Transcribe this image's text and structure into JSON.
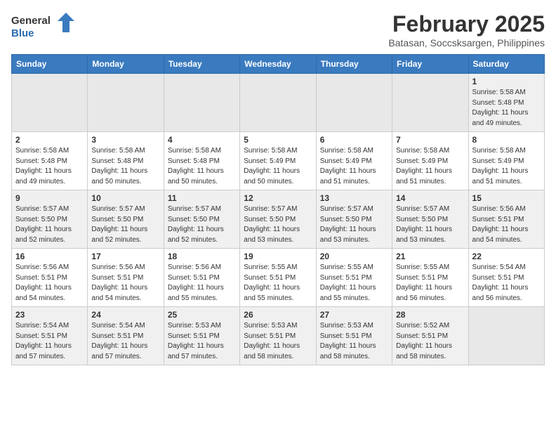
{
  "header": {
    "logo_general": "General",
    "logo_blue": "Blue",
    "month_year": "February 2025",
    "location": "Batasan, Soccsksargen, Philippines"
  },
  "days_of_week": [
    "Sunday",
    "Monday",
    "Tuesday",
    "Wednesday",
    "Thursday",
    "Friday",
    "Saturday"
  ],
  "weeks": [
    [
      {
        "day": "",
        "info": ""
      },
      {
        "day": "",
        "info": ""
      },
      {
        "day": "",
        "info": ""
      },
      {
        "day": "",
        "info": ""
      },
      {
        "day": "",
        "info": ""
      },
      {
        "day": "",
        "info": ""
      },
      {
        "day": "1",
        "info": "Sunrise: 5:58 AM\nSunset: 5:48 PM\nDaylight: 11 hours\nand 49 minutes."
      }
    ],
    [
      {
        "day": "2",
        "info": "Sunrise: 5:58 AM\nSunset: 5:48 PM\nDaylight: 11 hours\nand 49 minutes."
      },
      {
        "day": "3",
        "info": "Sunrise: 5:58 AM\nSunset: 5:48 PM\nDaylight: 11 hours\nand 50 minutes."
      },
      {
        "day": "4",
        "info": "Sunrise: 5:58 AM\nSunset: 5:48 PM\nDaylight: 11 hours\nand 50 minutes."
      },
      {
        "day": "5",
        "info": "Sunrise: 5:58 AM\nSunset: 5:49 PM\nDaylight: 11 hours\nand 50 minutes."
      },
      {
        "day": "6",
        "info": "Sunrise: 5:58 AM\nSunset: 5:49 PM\nDaylight: 11 hours\nand 51 minutes."
      },
      {
        "day": "7",
        "info": "Sunrise: 5:58 AM\nSunset: 5:49 PM\nDaylight: 11 hours\nand 51 minutes."
      },
      {
        "day": "8",
        "info": "Sunrise: 5:58 AM\nSunset: 5:49 PM\nDaylight: 11 hours\nand 51 minutes."
      }
    ],
    [
      {
        "day": "9",
        "info": "Sunrise: 5:57 AM\nSunset: 5:50 PM\nDaylight: 11 hours\nand 52 minutes."
      },
      {
        "day": "10",
        "info": "Sunrise: 5:57 AM\nSunset: 5:50 PM\nDaylight: 11 hours\nand 52 minutes."
      },
      {
        "day": "11",
        "info": "Sunrise: 5:57 AM\nSunset: 5:50 PM\nDaylight: 11 hours\nand 52 minutes."
      },
      {
        "day": "12",
        "info": "Sunrise: 5:57 AM\nSunset: 5:50 PM\nDaylight: 11 hours\nand 53 minutes."
      },
      {
        "day": "13",
        "info": "Sunrise: 5:57 AM\nSunset: 5:50 PM\nDaylight: 11 hours\nand 53 minutes."
      },
      {
        "day": "14",
        "info": "Sunrise: 5:57 AM\nSunset: 5:50 PM\nDaylight: 11 hours\nand 53 minutes."
      },
      {
        "day": "15",
        "info": "Sunrise: 5:56 AM\nSunset: 5:51 PM\nDaylight: 11 hours\nand 54 minutes."
      }
    ],
    [
      {
        "day": "16",
        "info": "Sunrise: 5:56 AM\nSunset: 5:51 PM\nDaylight: 11 hours\nand 54 minutes."
      },
      {
        "day": "17",
        "info": "Sunrise: 5:56 AM\nSunset: 5:51 PM\nDaylight: 11 hours\nand 54 minutes."
      },
      {
        "day": "18",
        "info": "Sunrise: 5:56 AM\nSunset: 5:51 PM\nDaylight: 11 hours\nand 55 minutes."
      },
      {
        "day": "19",
        "info": "Sunrise: 5:55 AM\nSunset: 5:51 PM\nDaylight: 11 hours\nand 55 minutes."
      },
      {
        "day": "20",
        "info": "Sunrise: 5:55 AM\nSunset: 5:51 PM\nDaylight: 11 hours\nand 55 minutes."
      },
      {
        "day": "21",
        "info": "Sunrise: 5:55 AM\nSunset: 5:51 PM\nDaylight: 11 hours\nand 56 minutes."
      },
      {
        "day": "22",
        "info": "Sunrise: 5:54 AM\nSunset: 5:51 PM\nDaylight: 11 hours\nand 56 minutes."
      }
    ],
    [
      {
        "day": "23",
        "info": "Sunrise: 5:54 AM\nSunset: 5:51 PM\nDaylight: 11 hours\nand 57 minutes."
      },
      {
        "day": "24",
        "info": "Sunrise: 5:54 AM\nSunset: 5:51 PM\nDaylight: 11 hours\nand 57 minutes."
      },
      {
        "day": "25",
        "info": "Sunrise: 5:53 AM\nSunset: 5:51 PM\nDaylight: 11 hours\nand 57 minutes."
      },
      {
        "day": "26",
        "info": "Sunrise: 5:53 AM\nSunset: 5:51 PM\nDaylight: 11 hours\nand 58 minutes."
      },
      {
        "day": "27",
        "info": "Sunrise: 5:53 AM\nSunset: 5:51 PM\nDaylight: 11 hours\nand 58 minutes."
      },
      {
        "day": "28",
        "info": "Sunrise: 5:52 AM\nSunset: 5:51 PM\nDaylight: 11 hours\nand 58 minutes."
      },
      {
        "day": "",
        "info": ""
      }
    ]
  ]
}
